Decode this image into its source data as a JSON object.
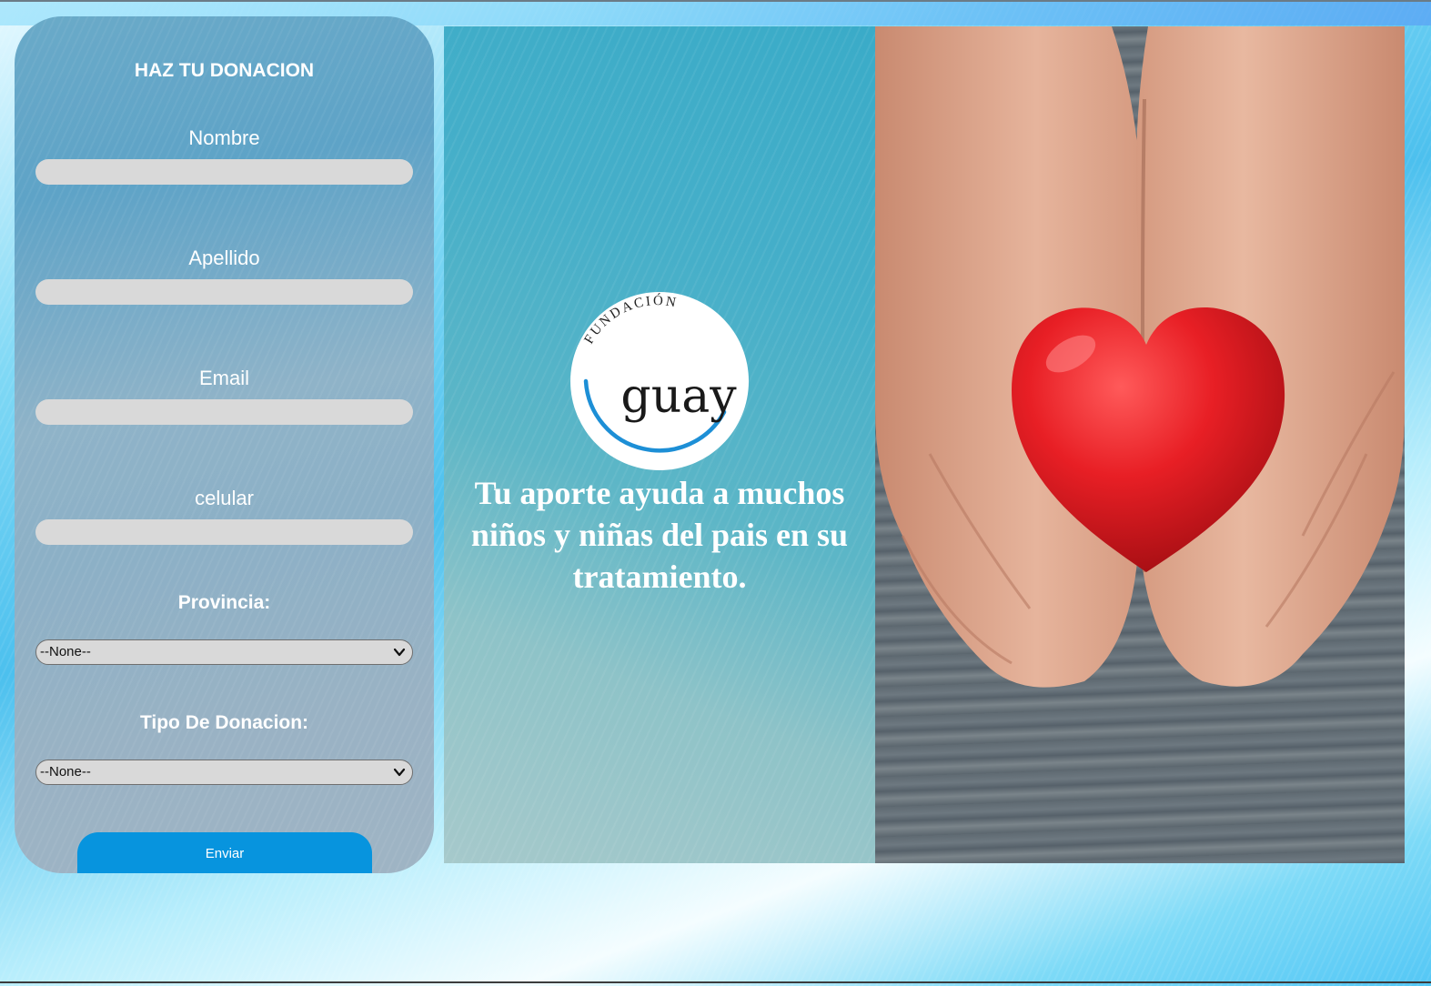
{
  "form": {
    "title": "HAZ TU DONACION",
    "nombre_label": "Nombre",
    "nombre_value": "",
    "apellido_label": "Apellido",
    "apellido_value": "",
    "email_label": "Email",
    "email_value": "",
    "celular_label": "celular",
    "celular_value": "",
    "provincia_label": "Provincia:",
    "provincia_selected": "--None--",
    "tipo_label": "Tipo De Donacion:",
    "tipo_selected": "--None--",
    "submit_label": "Enviar"
  },
  "hero": {
    "logo_arc_text": "FUNDACIÓN",
    "logo_word": "guay",
    "tagline": "Tu aporte ayuda a muchos niños y niñas del pais en su tratamiento.",
    "photo_subject": "hands-holding-red-heart"
  },
  "colors": {
    "accent_button": "#0794de",
    "input_bg": "#d9d9d9",
    "heart": "#e81f25",
    "logo_ring": "#1d8fd6"
  }
}
